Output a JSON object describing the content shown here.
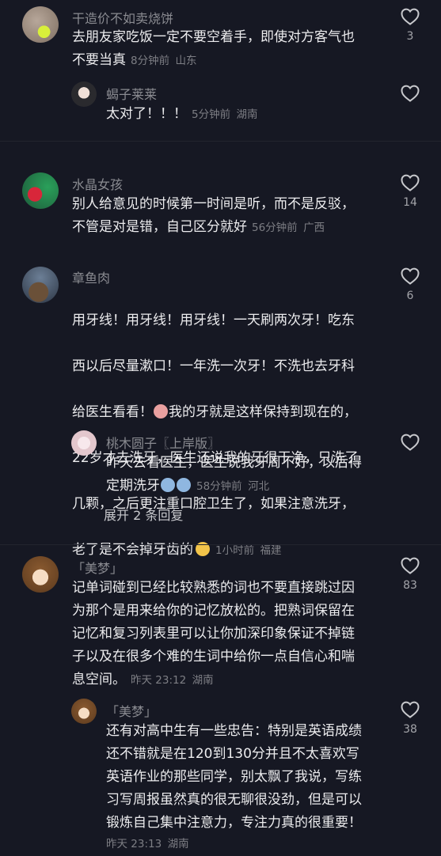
{
  "comments": [
    {
      "username": "干造价不如卖烧饼",
      "text": "去朋友家吃饭一定不要空着手，即使对方客气也\n不要当真",
      "time": "8分钟前",
      "location": "山东",
      "likes": "3",
      "replies": [
        {
          "username": "蝎子莱莱",
          "text": "太对了！！！",
          "time": "5分钟前",
          "location": "湖南",
          "likes": ""
        }
      ]
    },
    {
      "username": "水晶女孩",
      "text": "别人给意见的时候第一时间是听，而不是反驳，\n不管是对是错，自己区分就好",
      "time": "56分钟前",
      "location": "广西",
      "likes": "14"
    },
    {
      "username": "章鱼肉",
      "text_lines": [
        "用牙线！用牙线！用牙线！一天刷两次牙！吃东",
        "西以后尽量漱口！一年洗一次牙！不洗也去牙科",
        "给医生看看！",
        "我的牙就是这样保持到现在的，",
        "22岁才去洗牙，医生还说我的牙很干净，只洗了",
        "几颗，之后更注重口腔卫生了，如果注意洗牙，",
        "老了是不会掉牙齿的"
      ],
      "time": "1小时前",
      "location": "福建",
      "likes": "6",
      "replies": [
        {
          "username": "桃木圆子〖上岸版〗",
          "text": "昨天去看医生，医生说我牙周不好，以后得\n定期洗牙",
          "time": "58分钟前",
          "location": "河北",
          "likes": ""
        }
      ],
      "expand_label": "展开 2 条回复"
    },
    {
      "username": "「美梦」",
      "text": "记单词碰到已经比较熟悉的词也不要直接跳过因\n为那个是用来给你的记忆放松的。把熟词保留在\n记忆和复习列表里可以让你加深印象保证不掉链\n子以及在很多个难的生词中给你一点自信心和喘\n息空间。",
      "time": "昨天 23:12",
      "location": "湖南",
      "likes": "83",
      "replies": [
        {
          "username": "「美梦」",
          "text": "还有对高中生有一些忠告：特别是英语成绩\n还不错就是在120到130分并且不太喜欢写\n英语作业的那些同学，别太飘了我说，写练\n习写周报虽然真的很无聊很没劲，但是可以\n锻炼自己集中注意力，专注力真的很重要！",
          "time": "昨天 23:13",
          "location": "湖南",
          "likes": "38"
        }
      ]
    }
  ],
  "colors": {
    "background": "#161823",
    "text": "#ececee",
    "meta": "#7d7e84",
    "username": "#8a8b91"
  },
  "icons": {
    "like": "heart-outline-icon"
  }
}
